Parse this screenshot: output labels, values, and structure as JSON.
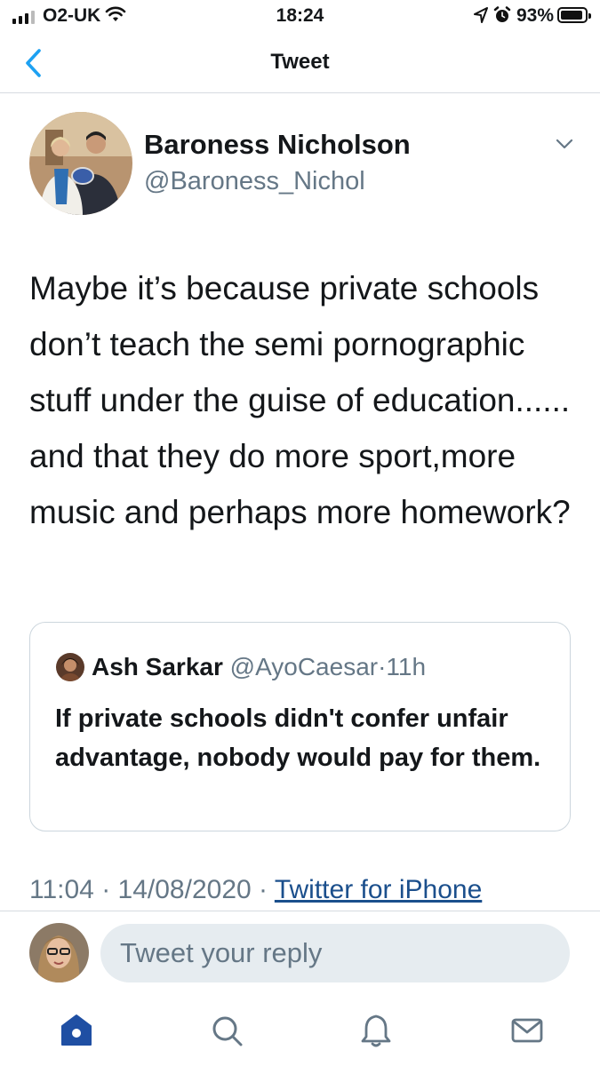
{
  "status_bar": {
    "carrier": "O2-UK",
    "time": "18:24",
    "battery_percent": "93%",
    "battery_level": 0.93,
    "icons": [
      "cellular-signal-icon",
      "wifi-icon",
      "location-arrow-icon",
      "alarm-clock-icon",
      "battery-icon"
    ]
  },
  "nav": {
    "title": "Tweet",
    "back_icon": "chevron-left-icon"
  },
  "tweet": {
    "author_name": "Baroness Nicholson",
    "author_handle": "@Baroness_Nichol",
    "menu_icon": "chevron-down-icon",
    "text": "Maybe it’s because private schools don’t teach the semi pornographic stuff under the guise of education...... and that they do more sport,more music and perhaps more homework?",
    "time": "11:04",
    "date": "14/08/2020",
    "separator": "·",
    "source": "Twitter for iPhone"
  },
  "quoted_tweet": {
    "author_name": "Ash Sarkar",
    "author_handle": "@AyoCaesar",
    "separator": "·",
    "age": "11h",
    "text": "If private schools didn't confer unfair advantage, nobody would pay for them."
  },
  "reply": {
    "placeholder": "Tweet your reply"
  },
  "tab_bar": {
    "items": [
      "home-icon",
      "search-icon",
      "notifications-icon",
      "messages-icon"
    ],
    "active": "home-icon"
  },
  "colors": {
    "text": "#14171a",
    "secondary": "#657786",
    "link": "#1b4f8c",
    "accent": "#1da1f2",
    "active_tab": "#1f4fa3",
    "divider": "#d6dbe0",
    "input_bg": "#e6ecf0"
  }
}
